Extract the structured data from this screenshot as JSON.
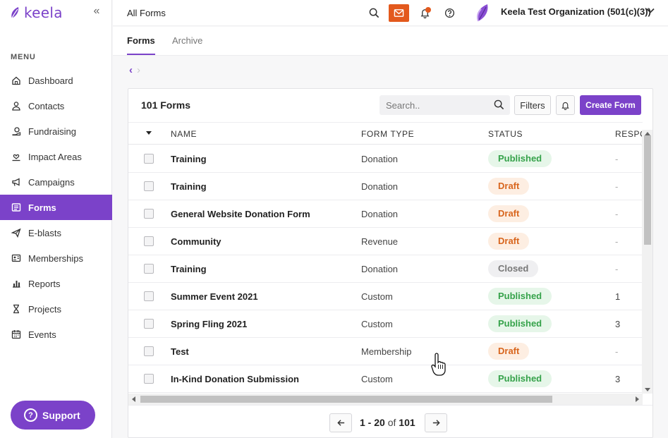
{
  "brand": {
    "name": "keela",
    "color": "#7b42c9"
  },
  "sidebar": {
    "collapse_icon": "double-chevron-left",
    "menu_heading": "MENU",
    "items": [
      {
        "label": "Dashboard",
        "icon": "home-icon",
        "active": false
      },
      {
        "label": "Contacts",
        "icon": "person-icon",
        "active": false
      },
      {
        "label": "Fundraising",
        "icon": "hand-coin-icon",
        "active": false
      },
      {
        "label": "Impact Areas",
        "icon": "hand-heart-icon",
        "active": false
      },
      {
        "label": "Campaigns",
        "icon": "megaphone-icon",
        "active": false
      },
      {
        "label": "Forms",
        "icon": "form-icon",
        "active": true
      },
      {
        "label": "E-blasts",
        "icon": "send-icon",
        "active": false
      },
      {
        "label": "Memberships",
        "icon": "id-card-icon",
        "active": false
      },
      {
        "label": "Reports",
        "icon": "bar-chart-icon",
        "active": false
      },
      {
        "label": "Projects",
        "icon": "hourglass-icon",
        "active": false
      },
      {
        "label": "Events",
        "icon": "calendar-icon",
        "active": false
      }
    ],
    "support_label": "Support"
  },
  "topbar": {
    "title": "All Forms",
    "org_name": "Keela Test Organization (501(c)(3))",
    "accent": "#e3591d"
  },
  "tabs": [
    {
      "label": "Forms",
      "active": true
    },
    {
      "label": "Archive",
      "active": false
    }
  ],
  "card": {
    "title": "101 Forms",
    "search_placeholder": "Search..",
    "filters_label": "Filters",
    "create_label": "Create Form"
  },
  "table": {
    "columns": [
      "NAME",
      "FORM TYPE",
      "STATUS",
      "RESPO"
    ],
    "rows": [
      {
        "name": "Training",
        "type": "Donation",
        "status": "Published",
        "responses": "-"
      },
      {
        "name": "Training",
        "type": "Donation",
        "status": "Draft",
        "responses": "-"
      },
      {
        "name": "General Website Donation Form",
        "type": "Donation",
        "status": "Draft",
        "responses": "-"
      },
      {
        "name": "Community",
        "type": "Revenue",
        "status": "Draft",
        "responses": "-"
      },
      {
        "name": "Training",
        "type": "Donation",
        "status": "Closed",
        "responses": "-"
      },
      {
        "name": "Summer Event 2021",
        "type": "Custom",
        "status": "Published",
        "responses": "1"
      },
      {
        "name": "Spring Fling 2021",
        "type": "Custom",
        "status": "Published",
        "responses": "3"
      },
      {
        "name": "Test",
        "type": "Membership",
        "status": "Draft",
        "responses": "-"
      },
      {
        "name": "In-Kind Donation Submission",
        "type": "Custom",
        "status": "Published",
        "responses": "3"
      }
    ]
  },
  "status_styles": {
    "Published": {
      "bg": "#e6f6e9",
      "fg": "#35a24a"
    },
    "Draft": {
      "bg": "#fdeee2",
      "fg": "#d8651d"
    },
    "Closed": {
      "bg": "#efeff1",
      "fg": "#777777"
    }
  },
  "pagination": {
    "range": "1 - 20",
    "of_label": "of",
    "total": "101"
  }
}
